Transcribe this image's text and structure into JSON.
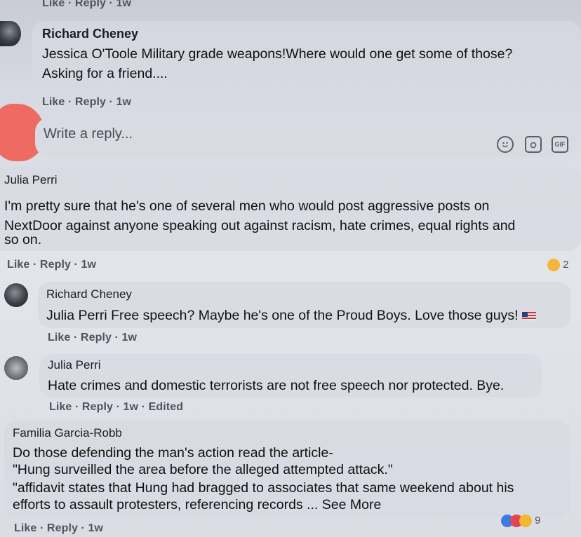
{
  "top_meta": "Like · Reply · 1w",
  "comments": [
    {
      "name": "Richard Cheney",
      "lines": [
        "Jessica O'Toole Military grade weapons!Where would one get some of those?",
        "Asking for a friend...."
      ],
      "meta": "Like · Reply · 1w"
    },
    {
      "name": "Julia Perri",
      "lines": [
        "I'm pretty sure that he's one of several men who would post aggressive posts on",
        "NextDoor against anyone speaking out against racism, hate crimes, equal rights and",
        "so on."
      ],
      "meta": "Like · Reply · 1w",
      "reaction_count": "2"
    },
    {
      "name": "Richard Cheney",
      "lines": [
        "Julia Perri Free speech? Maybe he's one of the Proud Boys. Love those guys!"
      ],
      "meta": "Like · Reply · 1w"
    },
    {
      "name": "Julia Perri",
      "lines": [
        "Hate crimes and domestic terrorists are not free speech nor protected. Bye."
      ],
      "meta": "Like · Reply · 1w · Edited"
    },
    {
      "name": "Familia Garcia-Robb",
      "lines": [
        "Do those defending the man's action read the article-",
        "\"Hung surveilled the area before the alleged attempted attack.\"",
        "\"affidavit states that Hung had bragged to associates that same weekend about his",
        "efforts to assault protesters, referencing records ... See More"
      ],
      "meta": "Like · Reply · 1w",
      "reaction_count": "9"
    }
  ],
  "reply_box": {
    "placeholder": "Write a reply...",
    "icons": [
      "smiley-icon",
      "camera-icon",
      "gif-icon"
    ],
    "gif_label": "GIF"
  },
  "colors": {
    "background": "#dadde4",
    "meta": "#50545c",
    "redaction": "#f06a64"
  }
}
